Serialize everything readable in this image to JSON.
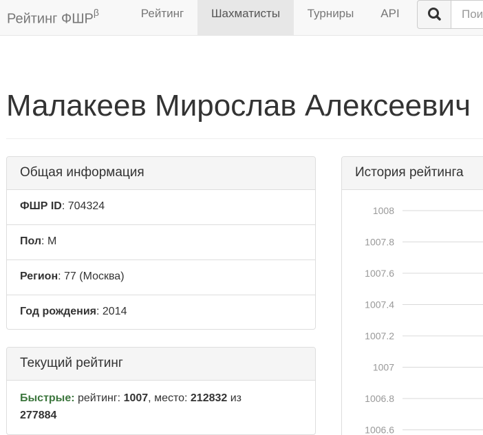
{
  "navbar": {
    "brand": "Рейтинг ФШР",
    "brand_sup": "β",
    "items": [
      {
        "label": "Рейтинг",
        "active": false
      },
      {
        "label": "Шахматисты",
        "active": true
      },
      {
        "label": "Турниры",
        "active": false
      },
      {
        "label": "API",
        "active": false
      }
    ],
    "search_icon": "search-icon",
    "search_placeholder": "Поиск"
  },
  "player": {
    "name": "Малакеев Мирослав Алексеевич"
  },
  "general_info": {
    "title": "Общая информация",
    "rows": [
      {
        "label": "ФШР ID",
        "value": "704324",
        "sep": ": "
      },
      {
        "label": "Пол",
        "value": "М",
        "sep": ": "
      },
      {
        "label": "Регион",
        "value": "77 (Москва)",
        "sep": ": "
      },
      {
        "label": "Год рождения",
        "value": "2014",
        "sep": ": "
      }
    ]
  },
  "current_rating": {
    "title": "Текущий рейтинг",
    "category": "Быстрые:",
    "rating_label": " рейтинг: ",
    "rating": "1007",
    "place_label": ", место: ",
    "place": "212832",
    "of_label": " из",
    "total": "277884"
  },
  "rating_history": {
    "title": "История рейтинга"
  },
  "chart_data": {
    "type": "line",
    "title": "",
    "xlabel": "",
    "ylabel": "",
    "yticks": [
      1008,
      1007.8,
      1007.6,
      1007.4,
      1007.2,
      1007,
      1006.8,
      1006.6
    ],
    "ytick_labels": [
      "1008",
      "1007.8",
      "1007.6",
      "1007.4",
      "1007.2",
      "1007",
      "1006.8",
      "1006.6"
    ],
    "ylim": [
      1006.6,
      1008
    ],
    "grid": true,
    "series": []
  }
}
